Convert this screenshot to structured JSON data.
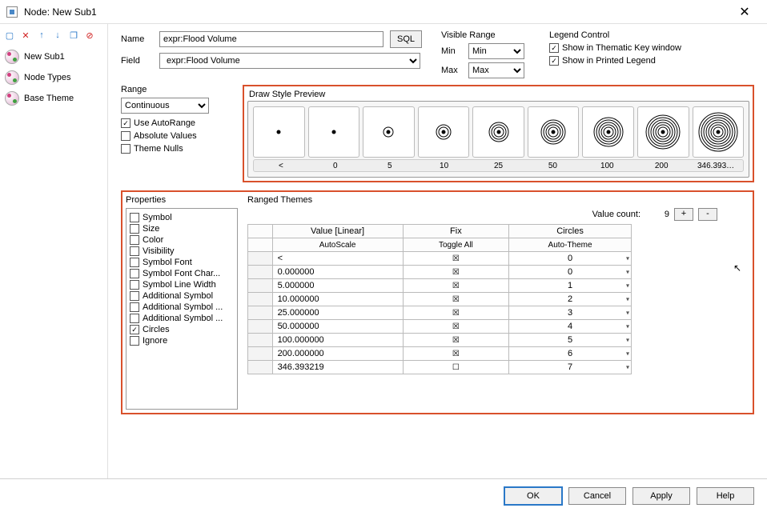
{
  "window": {
    "title": "Node: New Sub1"
  },
  "sidebar": {
    "items": [
      {
        "label": "New Sub1"
      },
      {
        "label": "Node Types"
      },
      {
        "label": "Base Theme"
      }
    ]
  },
  "fields": {
    "name_label": "Name",
    "name_value": "expr:Flood Volume",
    "field_label": "Field",
    "field_value": "expr:Flood Volume",
    "sql_btn": "SQL"
  },
  "visible_range": {
    "title": "Visible Range",
    "min_label": "Min",
    "min_value": "Min",
    "max_label": "Max",
    "max_value": "Max"
  },
  "legend": {
    "title": "Legend Control",
    "thematic": "Show in Thematic Key window",
    "printed": "Show in Printed Legend"
  },
  "range": {
    "title": "Range",
    "mode": "Continuous",
    "auto": "Use AutoRange",
    "abs": "Absolute Values",
    "nulls": "Theme Nulls"
  },
  "preview": {
    "title": "Draw Style Preview",
    "labels": [
      "<",
      "0",
      "5",
      "10",
      "25",
      "50",
      "100",
      "200",
      "346.393…"
    ],
    "rings": [
      0,
      0,
      1,
      2,
      3,
      4,
      5,
      6,
      7
    ]
  },
  "properties": {
    "title": "Properties",
    "items": [
      {
        "label": "Symbol",
        "checked": false
      },
      {
        "label": "Size",
        "checked": false
      },
      {
        "label": "Color",
        "checked": false
      },
      {
        "label": "Visibility",
        "checked": false
      },
      {
        "label": "Symbol Font",
        "checked": false
      },
      {
        "label": "Symbol Font Char...",
        "checked": false
      },
      {
        "label": "Symbol Line Width",
        "checked": false
      },
      {
        "label": "Additional Symbol",
        "checked": false
      },
      {
        "label": "Additional Symbol ...",
        "checked": false
      },
      {
        "label": "Additional Symbol ...",
        "checked": false
      },
      {
        "label": "Circles",
        "checked": true
      },
      {
        "label": "Ignore",
        "checked": false
      }
    ]
  },
  "ranged_themes": {
    "title": "Ranged Themes",
    "value_count_label": "Value count:",
    "value_count": "9",
    "headers": {
      "value": "Value [Linear]",
      "fix": "Fix",
      "circles": "Circles"
    },
    "subheaders": {
      "auto_scale": "AutoScale",
      "toggle_all": "Toggle All",
      "auto_theme": "Auto-Theme"
    },
    "rows": [
      {
        "value": "<",
        "fix": true,
        "circles": "0"
      },
      {
        "value": "0.000000",
        "fix": true,
        "circles": "0"
      },
      {
        "value": "5.000000",
        "fix": true,
        "circles": "1"
      },
      {
        "value": "10.000000",
        "fix": true,
        "circles": "2"
      },
      {
        "value": "25.000000",
        "fix": true,
        "circles": "3"
      },
      {
        "value": "50.000000",
        "fix": true,
        "circles": "4"
      },
      {
        "value": "100.000000",
        "fix": true,
        "circles": "5"
      },
      {
        "value": "200.000000",
        "fix": true,
        "circles": "6"
      },
      {
        "value": "346.393219",
        "fix": false,
        "circles": "7"
      }
    ]
  },
  "footer": {
    "ok": "OK",
    "cancel": "Cancel",
    "apply": "Apply",
    "help": "Help"
  },
  "colors": {
    "highlight": "#d9512c"
  }
}
